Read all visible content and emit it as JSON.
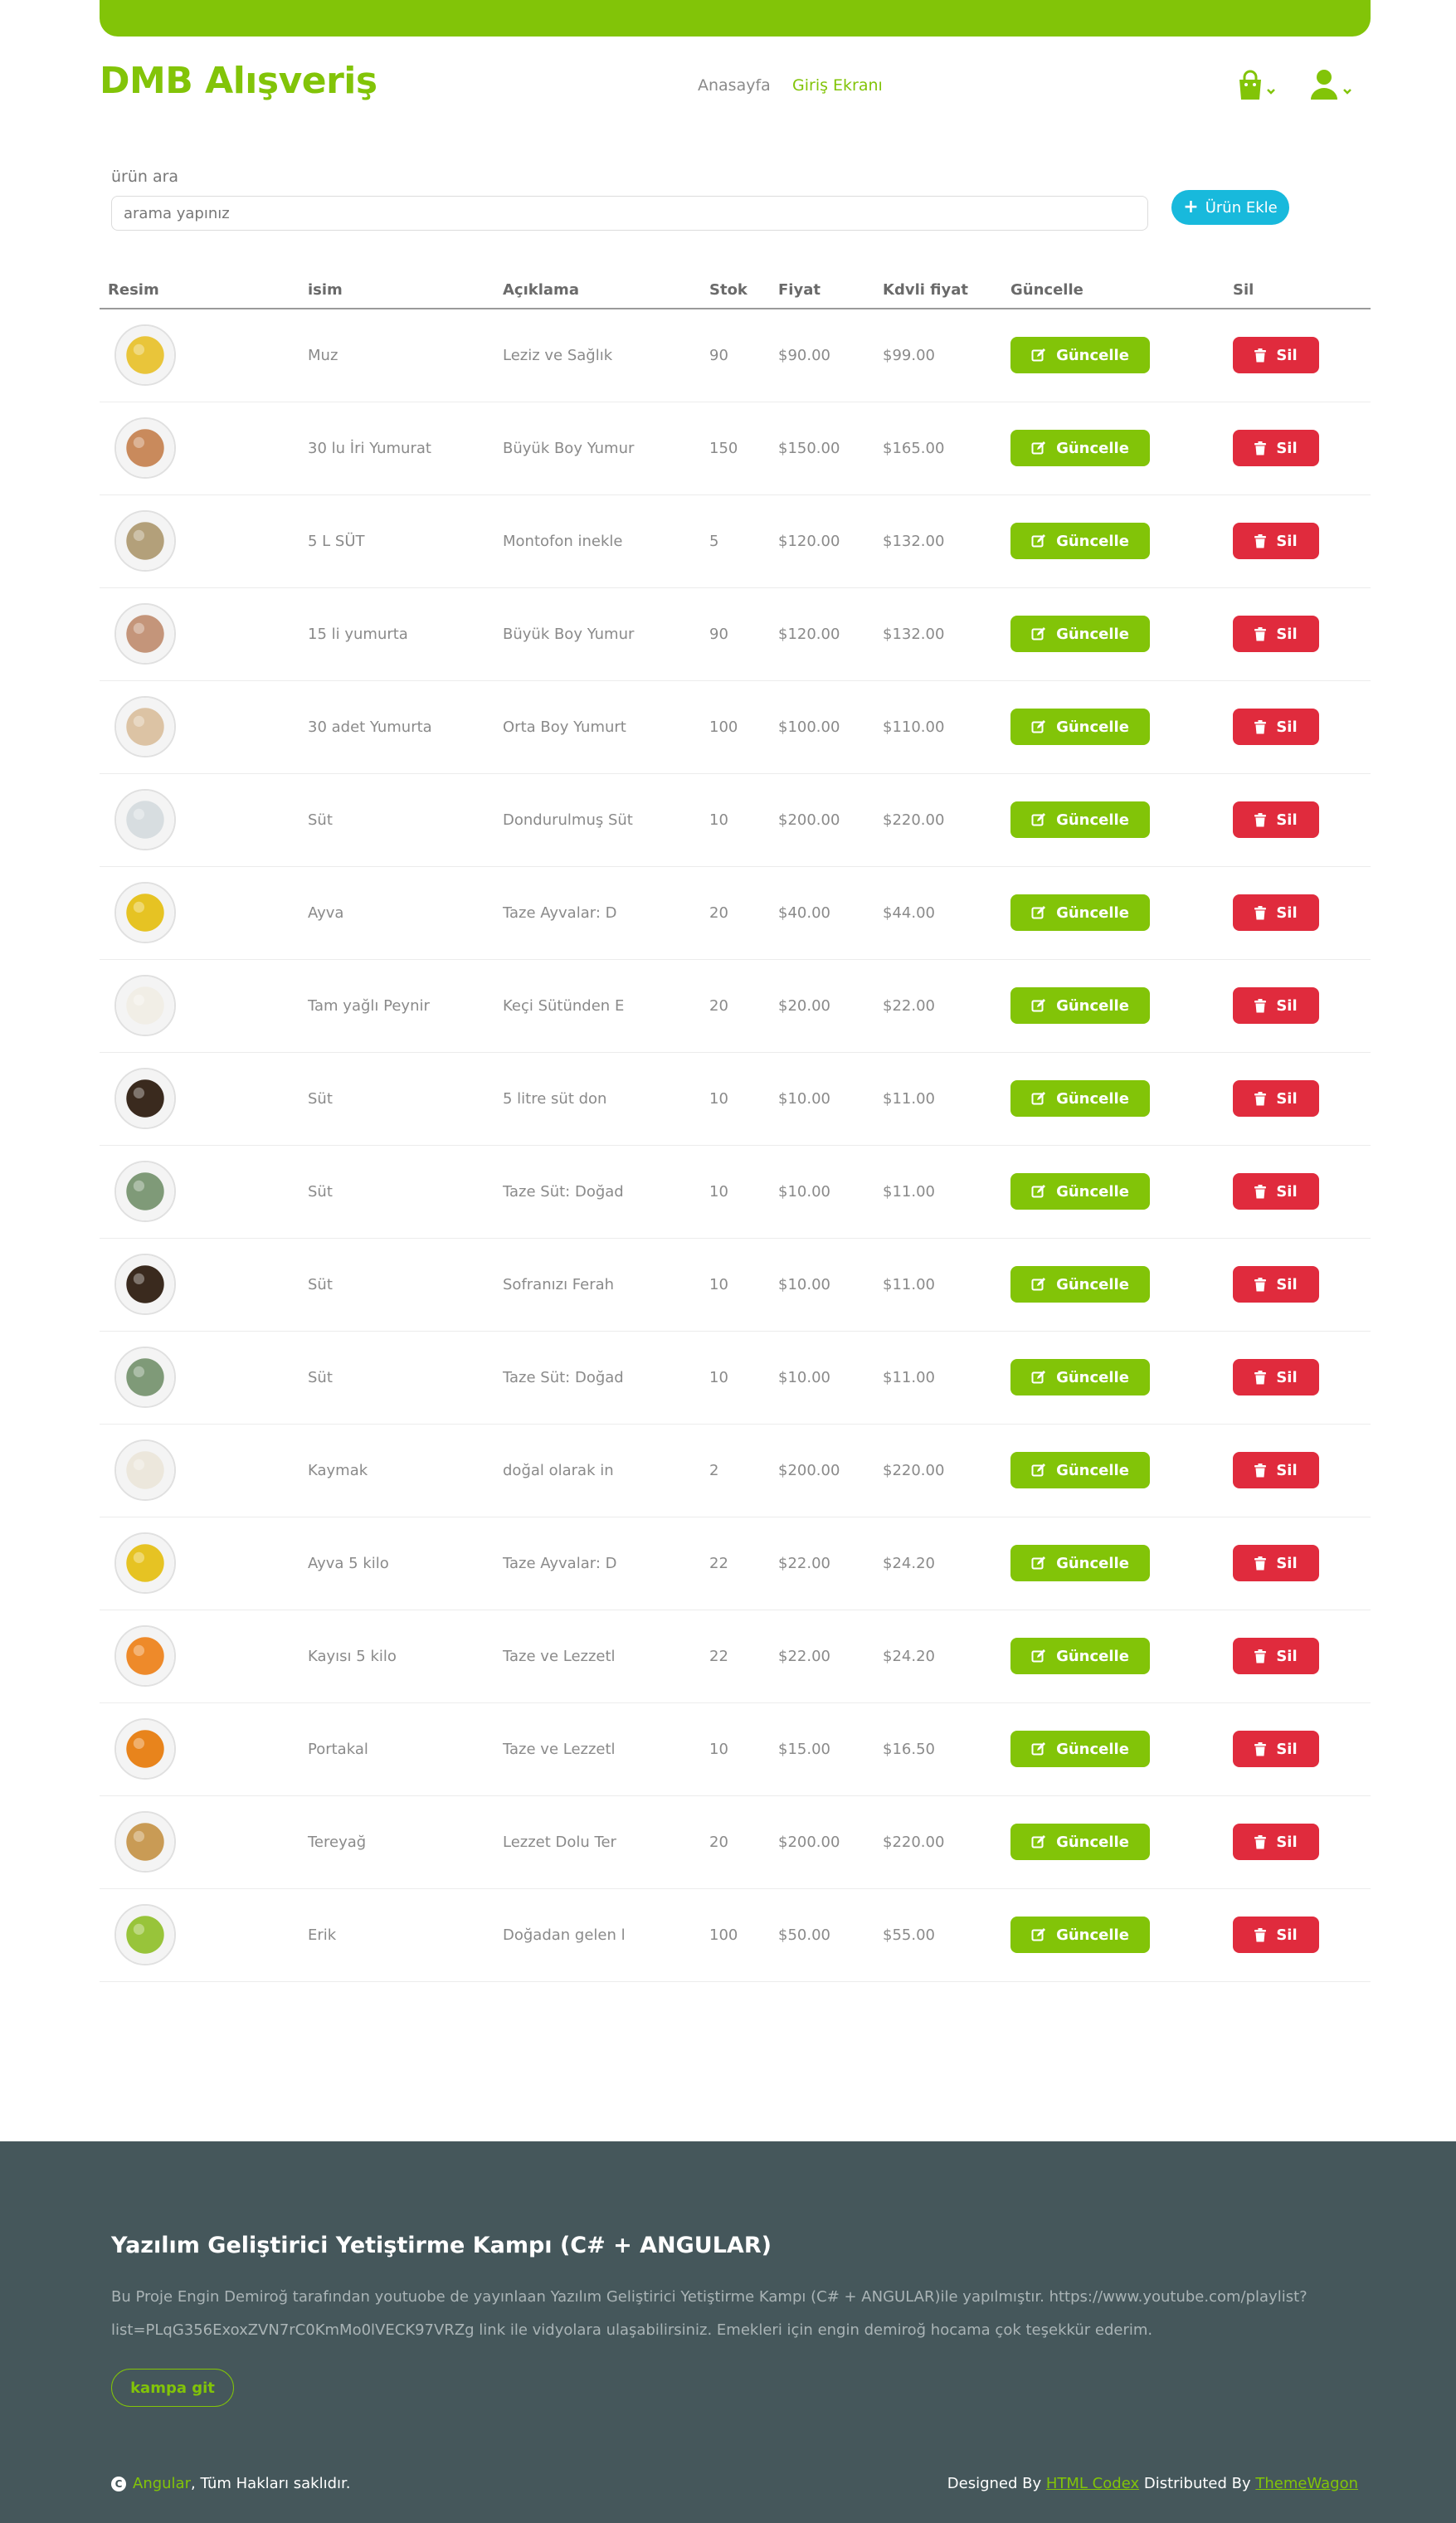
{
  "brand": "DMB Alışveriş",
  "nav": {
    "home": "Anasayfa",
    "login": "Giriş Ekranı"
  },
  "search": {
    "label": "ürün ara",
    "placeholder": "arama yapınız"
  },
  "add_button": "Ürün Ekle",
  "table": {
    "headers": [
      "Resim",
      "isim",
      "Açıklama",
      "Stok",
      "Fiyat",
      "Kdvli fiyat",
      "Güncelle",
      "Sil"
    ],
    "update_label": "Güncelle",
    "delete_label": "Sil",
    "rows": [
      {
        "name": "Muz",
        "desc": "Leziz ve Sağlık",
        "stock": "90",
        "price": "$90.00",
        "vat_price": "$99.00",
        "img": "banana",
        "color": "#e9c53a"
      },
      {
        "name": "30 lu İri Yumurat",
        "desc": "Büyük Boy Yumur",
        "stock": "150",
        "price": "$150.00",
        "vat_price": "$165.00",
        "img": "eggs",
        "color": "#c98a5c"
      },
      {
        "name": "5 L SÜT",
        "desc": "Montofon inekle",
        "stock": "5",
        "price": "$120.00",
        "vat_price": "$132.00",
        "img": "milk-bottles",
        "color": "#b3a07a"
      },
      {
        "name": "15 li yumurta",
        "desc": "Büyük Boy Yumur",
        "stock": "90",
        "price": "$120.00",
        "vat_price": "$132.00",
        "img": "eggs",
        "color": "#c4957a"
      },
      {
        "name": "30 adet Yumurta",
        "desc": "Orta Boy Yumurt",
        "stock": "100",
        "price": "$100.00",
        "vat_price": "$110.00",
        "img": "eggs",
        "color": "#dcc3a4"
      },
      {
        "name": "Süt",
        "desc": "Dondurulmuş Süt",
        "stock": "10",
        "price": "$200.00",
        "vat_price": "$220.00",
        "img": "milk",
        "color": "#d7dde0"
      },
      {
        "name": "Ayva",
        "desc": "Taze Ayvalar: D",
        "stock": "20",
        "price": "$40.00",
        "vat_price": "$44.00",
        "img": "quince",
        "color": "#e6c323"
      },
      {
        "name": "Tam yağlı Peynir",
        "desc": "Keçi Sütünden E",
        "stock": "20",
        "price": "$20.00",
        "vat_price": "$22.00",
        "img": "cheese",
        "color": "#f1eee6"
      },
      {
        "name": "Süt",
        "desc": "5 litre süt don",
        "stock": "10",
        "price": "$10.00",
        "vat_price": "$11.00",
        "img": "milk-dark",
        "color": "#3a2a1e"
      },
      {
        "name": "Süt",
        "desc": "Taze Süt: Doğad",
        "stock": "10",
        "price": "$10.00",
        "vat_price": "$11.00",
        "img": "milk-farm",
        "color": "#7f9a78"
      },
      {
        "name": "Süt",
        "desc": "Sofranızı Ferah",
        "stock": "10",
        "price": "$10.00",
        "vat_price": "$11.00",
        "img": "milk-dark",
        "color": "#3a2a1e"
      },
      {
        "name": "Süt",
        "desc": "Taze Süt: Doğad",
        "stock": "10",
        "price": "$10.00",
        "vat_price": "$11.00",
        "img": "milk-farm",
        "color": "#7f9a78"
      },
      {
        "name": "Kaymak",
        "desc": "doğal olarak in",
        "stock": "2",
        "price": "$200.00",
        "vat_price": "$220.00",
        "img": "cream",
        "color": "#ece7dc"
      },
      {
        "name": "Ayva 5 kilo",
        "desc": "Taze Ayvalar: D",
        "stock": "22",
        "price": "$22.00",
        "vat_price": "$24.20",
        "img": "quince",
        "color": "#e6c323"
      },
      {
        "name": "Kayısı 5 kilo",
        "desc": "Taze ve Lezzetl",
        "stock": "22",
        "price": "$22.00",
        "vat_price": "$24.20",
        "img": "apricot",
        "color": "#ee8a2a"
      },
      {
        "name": "Portakal",
        "desc": "Taze ve Lezzetl",
        "stock": "10",
        "price": "$15.00",
        "vat_price": "$16.50",
        "img": "orange",
        "color": "#e8841c"
      },
      {
        "name": "Tereyağ",
        "desc": "Lezzet Dolu Ter",
        "stock": "20",
        "price": "$200.00",
        "vat_price": "$220.00",
        "img": "butter",
        "color": "#c99b55"
      },
      {
        "name": "Erik",
        "desc": "Doğadan gelen l",
        "stock": "100",
        "price": "$50.00",
        "vat_price": "$55.00",
        "img": "plum",
        "color": "#98c43a"
      }
    ]
  },
  "footer": {
    "title": "Yazılım Geliştirici Yetiştirme Kampı (C# + ANGULAR)",
    "text": "Bu Proje Engin Demiroğ tarafından youtuobe de yayınlaan Yazılım Geliştirici Yetiştirme Kampı (C# + ANGULAR)ile yapılmıştır. https://www.youtube.com/playlist?list=PLqG356ExoxZVN7rC0KmMo0lVECK97VRZg link ile vidyolara ulaşabilirsiniz. Emekleri için engin demiroğ hocama çok teşekkür ederim.",
    "button": "kampa git",
    "copyright_link": "Angular",
    "copyright_rest": ", Tüm Hakları saklıdır.",
    "designed_by": "Designed By",
    "designer": "HTML Codex",
    "distributed_by": "Distributed By",
    "distributor": "ThemeWagon"
  },
  "colors": {
    "accent": "#82c408",
    "danger": "#e02b3d",
    "info": "#18b9dc",
    "footer_bg": "#45575b"
  }
}
